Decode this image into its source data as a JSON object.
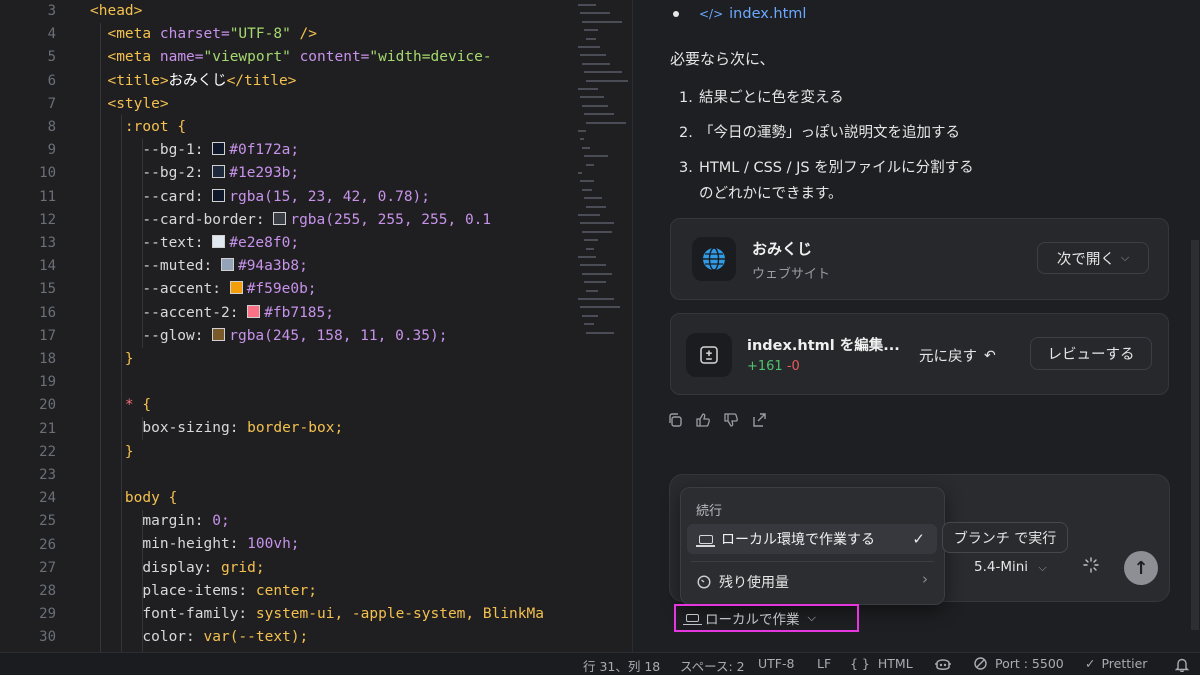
{
  "editor": {
    "line_numbers": [
      "3",
      "4",
      "5",
      "6",
      "7",
      "8",
      "9",
      "10",
      "11",
      "12",
      "13",
      "14",
      "15",
      "16",
      "17",
      "18",
      "19",
      "20",
      "21",
      "22",
      "23",
      "24",
      "25",
      "26",
      "27",
      "28",
      "29",
      "30"
    ],
    "code_text": {
      "head_open": "<head>",
      "meta_charset_tag": "<meta",
      "meta_charset_attr": "charset=",
      "meta_charset_val": "\"UTF-8\"",
      "meta_close": " />",
      "meta_viewport_tag": "<meta",
      "meta_viewport_name_attr": "name=",
      "meta_viewport_name_val": "\"viewport\"",
      "meta_viewport_content_attr": "content=",
      "meta_viewport_content_val": "\"width=device-",
      "title_open": "<title>",
      "title_text": "おみくじ",
      "title_close": "</title>",
      "style_open": "<style>",
      "root_selector": ":root",
      "brace_open": "{",
      "brace_close": "}",
      "vars": [
        {
          "prop": "--bg-1:",
          "value": "#0f172a;",
          "swatch": "#0f172a"
        },
        {
          "prop": "--bg-2:",
          "value": "#1e293b;",
          "swatch": "#1e293b"
        },
        {
          "prop": "--card:",
          "value": "rgba(15, 23, 42, 0.78);",
          "swatch": "#0f172a"
        },
        {
          "prop": "--card-border:",
          "value": "rgba(255, 255, 255, 0.1",
          "swatch": "#3a3d44"
        },
        {
          "prop": "--text:",
          "value": "#e2e8f0;",
          "swatch": "#e2e8f0"
        },
        {
          "prop": "--muted:",
          "value": "#94a3b8;",
          "swatch": "#94a3b8"
        },
        {
          "prop": "--accent:",
          "value": "#f59e0b;",
          "swatch": "#f59e0b"
        },
        {
          "prop": "--accent-2:",
          "value": "#fb7185;",
          "swatch": "#fb7185"
        },
        {
          "prop": "--glow:",
          "value": "rgba(245, 158, 11, 0.35);",
          "swatch": "#7a5a2a"
        }
      ],
      "star_selector": "*",
      "box_sizing_prop": "box-sizing:",
      "box_sizing_val": "border-box;",
      "body_selector": "body",
      "body_props": [
        {
          "prop": "margin:",
          "value": "0;"
        },
        {
          "prop": "min-height:",
          "value": "100vh;"
        },
        {
          "prop": "display:",
          "value": "grid;"
        },
        {
          "prop": "place-items:",
          "value": "center;"
        },
        {
          "prop": "font-family:",
          "value": "system-ui, -apple-system, BlinkMa"
        },
        {
          "prop": "color:",
          "value": "var(--text);"
        }
      ]
    }
  },
  "chat": {
    "file_link": "index.html",
    "file_link_icon": "</>",
    "intro": "必要なら次に、",
    "options": [
      {
        "num": "1.",
        "text": "結果ごとに色を変える"
      },
      {
        "num": "2.",
        "text": "「今日の運勢」っぽい説明文を追加する"
      },
      {
        "num": "3.",
        "text": "HTML / CSS / JS を別ファイルに分割する"
      }
    ],
    "options_tail": "のどれかにできます。",
    "site_card": {
      "title": "おみくじ",
      "subtitle": "ウェブサイト",
      "open_label": "次で開く"
    },
    "edit_card": {
      "title": "index.html を編集...",
      "added": "+161",
      "removed": "-0",
      "undo_label": "元に戻す",
      "review_label": "レビューする"
    },
    "popover": {
      "header": "続行",
      "selected_option": "ローカル環境で作業する",
      "usage_label": "残り使用量"
    },
    "branch_label": "ブランチ で実行",
    "model_label": "5.4-Mini",
    "local_label": "ローカルで作業"
  },
  "status_bar": {
    "position": "行 31、列 18",
    "spaces": "スペース: 2",
    "encoding": "UTF-8",
    "eol": "LF",
    "language": "HTML",
    "language_icon": "{ }",
    "port": "Port : 5500",
    "formatter": "Prettier"
  }
}
